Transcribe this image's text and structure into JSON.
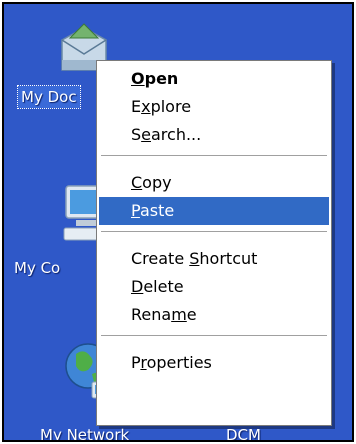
{
  "desktop": {
    "background": "#2f58c8",
    "icons": [
      {
        "name": "my-documents",
        "label": "My Doc",
        "icon": "folder-envelope-icon"
      },
      {
        "name": "my-computer",
        "label": "My Co",
        "icon": "computer-icon"
      },
      {
        "name": "my-network",
        "label": "My Network",
        "icon": "globe-network-icon"
      },
      {
        "name": "dcm",
        "label": "DCM",
        "icon": "shortcut-icon"
      }
    ]
  },
  "menu": {
    "selected_color": "#316ac5",
    "items": [
      {
        "label": "Open",
        "accel": "O",
        "bold": true
      },
      {
        "label": "Explore",
        "accel": "x"
      },
      {
        "label": "Search...",
        "accel": "e"
      },
      {
        "label": "Copy",
        "accel": "C"
      },
      {
        "label": "Paste",
        "accel": "P",
        "selected": true
      },
      {
        "label": "Create Shortcut",
        "accel": "S"
      },
      {
        "label": "Delete",
        "accel": "D"
      },
      {
        "label": "Rename",
        "accel": "m"
      },
      {
        "label": "Properties",
        "accel": "r"
      }
    ]
  }
}
